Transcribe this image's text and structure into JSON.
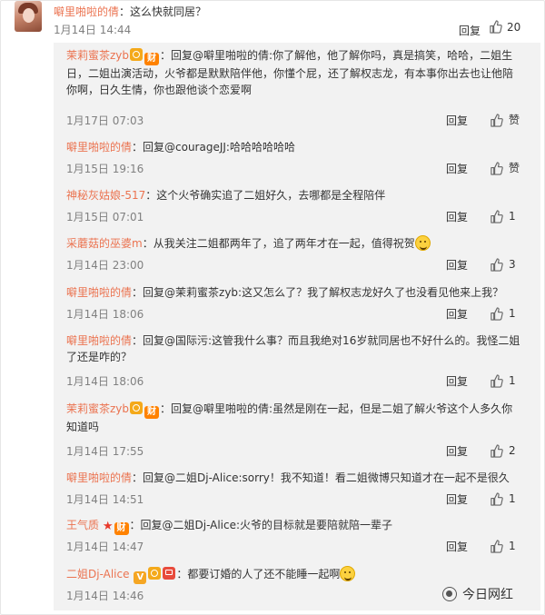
{
  "top_comment": {
    "user": "噼里啪啦的倩",
    "text": "：这么快就同居？",
    "time": "1月14日 14:44",
    "reply_label": "回复",
    "likes": "20"
  },
  "replies": [
    {
      "user": "茉莉蜜茶zyb",
      "badges": [
        "gold",
        "cai"
      ],
      "text": "：回复@噼里啪啦的倩:你了解他，他了解你吗，真是搞笑，哈哈，二姐生日，二姐出演活动，火爷都是默默陪伴他，你懂个屁，还了解权志龙，有本事你出去也让他陪你啊，日久生情，你也跟他谈个恋爱啊",
      "time": "1月17日 07:03",
      "reply_label": "回复",
      "likes": "赞"
    },
    {
      "user": "噼里啪啦的倩",
      "badges": [],
      "text": "：回复@courageJJ:哈哈哈哈哈哈",
      "time": "1月15日 19:16",
      "reply_label": "回复",
      "likes": "赞"
    },
    {
      "user": "神秘灰姑娘-517",
      "badges": [],
      "text": "：这个火爷确实追了二姐好久，去哪都是全程陪伴",
      "time": "1月15日 07:01",
      "reply_label": "回复",
      "likes": "1"
    },
    {
      "user": "采蘑菇的巫婆m",
      "badges": [],
      "text": "：从我关注二姐都两年了，追了两年才在一起，值得祝贺",
      "emoji": true,
      "time": "1月14日 23:00",
      "reply_label": "回复",
      "likes": "3"
    },
    {
      "user": "噼里啪啦的倩",
      "badges": [],
      "text": "：回复@茉莉蜜茶zyb:这又怎么了？我了解权志龙好久了也没看见他来上我？",
      "time": "1月14日 18:06",
      "reply_label": "回复",
      "likes": "1"
    },
    {
      "user": "噼里啪啦的倩",
      "badges": [],
      "text": "：回复@国际污:这管我什么事？而且我绝对16岁就同居也不好什么的。我怪二姐了还是咋的？",
      "time": "1月14日 18:06",
      "reply_label": "回复",
      "likes": "1"
    },
    {
      "user": "茉莉蜜茶zyb",
      "badges": [
        "gold",
        "cai"
      ],
      "text": "：回复@噼里啪啦的倩:虽然是刚在一起，但是二姐了解火爷这个人多久你知道吗",
      "time": "1月14日 17:55",
      "reply_label": "回复",
      "likes": "2"
    },
    {
      "user": "噼里啪啦的倩",
      "badges": [],
      "text": "：回复@二姐Dj-Alice:sorry！我不知道！看二姐微博只知道才在一起不是很久",
      "time": "1月14日 14:51",
      "reply_label": "回复",
      "likes": "1"
    },
    {
      "user": "王气质",
      "badges": [
        "star",
        "cai"
      ],
      "text": "：回复@二姐Dj-Alice:火爷的目标就是要陪就陪一辈子",
      "time": "1月14日 14:47",
      "reply_label": "回复",
      "likes": "1"
    },
    {
      "user": "二姐Dj-Alice",
      "badges": [
        "vip",
        "gold",
        "red"
      ],
      "text": "：都要订婚的人了还不能睡一起啊",
      "emoji": true,
      "time": "1月14日 14:46",
      "reply_label": "",
      "likes": ""
    }
  ],
  "watermark": {
    "text": "今日网红"
  },
  "colors": {
    "name": "#eb7350",
    "panel_bg": "#f2f2f2",
    "time": "#808080"
  },
  "icons": {
    "like": "thumbs-up-icon",
    "badge_cai": "财",
    "badge_vip": "V"
  }
}
